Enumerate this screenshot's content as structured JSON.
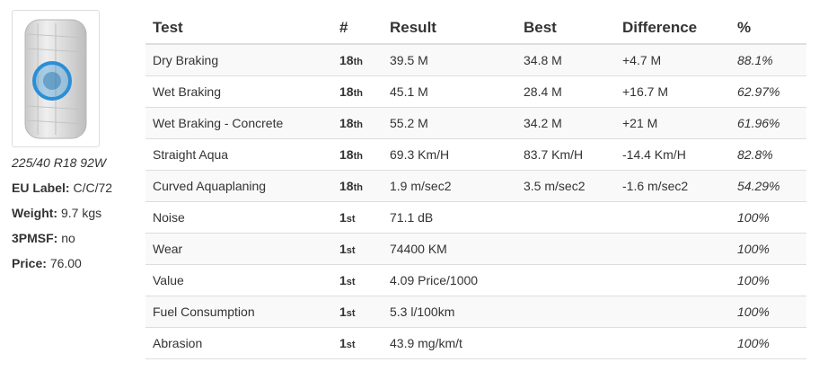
{
  "tyre": {
    "size": "225/40 R18 92W",
    "eu_label": {
      "label": "EU Label:",
      "value": "C/C/72"
    },
    "weight": {
      "label": "Weight:",
      "value": "9.7 kgs"
    },
    "threepmsf": {
      "label": "3PMSF:",
      "value": "no"
    },
    "price": {
      "label": "Price:",
      "value": "76.00"
    }
  },
  "table": {
    "headers": {
      "test": "Test",
      "rank": "#",
      "result": "Result",
      "best": "Best",
      "difference": "Difference",
      "percent": "%"
    },
    "rows": [
      {
        "test": "Dry Braking",
        "rank": "18",
        "suffix": "th",
        "result": "39.5 M",
        "best": "34.8 M",
        "difference": "+4.7 M",
        "percent": "88.1%"
      },
      {
        "test": "Wet Braking",
        "rank": "18",
        "suffix": "th",
        "result": "45.1 M",
        "best": "28.4 M",
        "difference": "+16.7 M",
        "percent": "62.97%"
      },
      {
        "test": "Wet Braking - Concrete",
        "rank": "18",
        "suffix": "th",
        "result": "55.2 M",
        "best": "34.2 M",
        "difference": "+21 M",
        "percent": "61.96%"
      },
      {
        "test": "Straight Aqua",
        "rank": "18",
        "suffix": "th",
        "result": "69.3 Km/H",
        "best": "83.7 Km/H",
        "difference": "-14.4 Km/H",
        "percent": "82.8%"
      },
      {
        "test": "Curved Aquaplaning",
        "rank": "18",
        "suffix": "th",
        "result": "1.9 m/sec2",
        "best": "3.5 m/sec2",
        "difference": "-1.6 m/sec2",
        "percent": "54.29%"
      },
      {
        "test": "Noise",
        "rank": "1",
        "suffix": "st",
        "result": "71.1 dB",
        "best": "",
        "difference": "",
        "percent": "100%"
      },
      {
        "test": "Wear",
        "rank": "1",
        "suffix": "st",
        "result": "74400 KM",
        "best": "",
        "difference": "",
        "percent": "100%"
      },
      {
        "test": "Value",
        "rank": "1",
        "suffix": "st",
        "result": "4.09 Price/1000",
        "best": "",
        "difference": "",
        "percent": "100%"
      },
      {
        "test": "Fuel Consumption",
        "rank": "1",
        "suffix": "st",
        "result": "5.3 l/100km",
        "best": "",
        "difference": "",
        "percent": "100%"
      },
      {
        "test": "Abrasion",
        "rank": "1",
        "suffix": "st",
        "result": "43.9 mg/km/t",
        "best": "",
        "difference": "",
        "percent": "100%"
      }
    ]
  },
  "colors": {
    "border": "#dddddd",
    "stripe": "#f9f9f9",
    "highlight": "#2a8fd6"
  }
}
